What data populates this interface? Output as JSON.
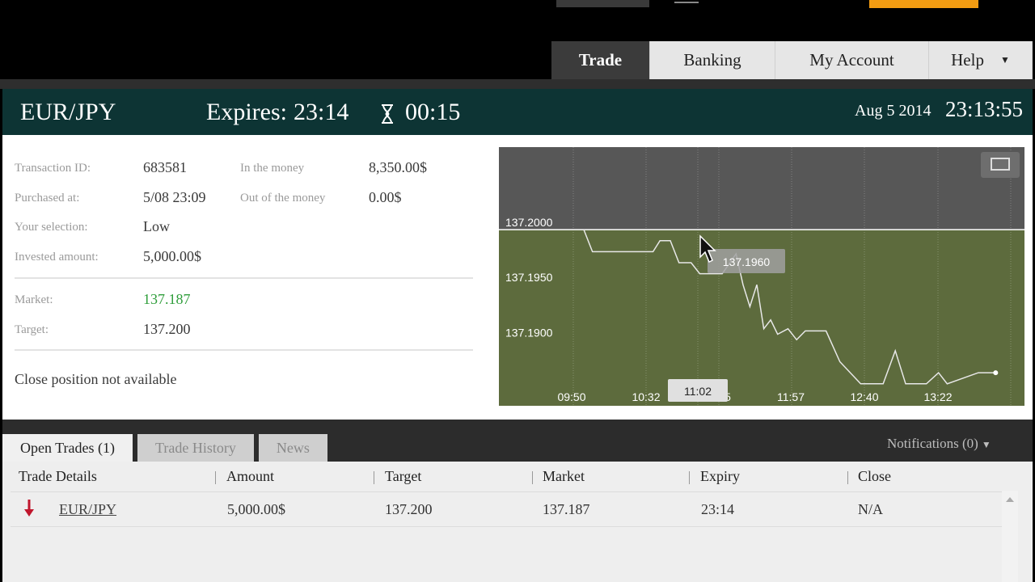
{
  "nav": {
    "tabs": [
      {
        "label": "Trade",
        "active": true
      },
      {
        "label": "Banking",
        "active": false
      },
      {
        "label": "My Account",
        "active": false
      },
      {
        "label": "Help",
        "active": false
      }
    ]
  },
  "header": {
    "asset": "EUR/JPY",
    "expires_label": "Expires:",
    "expires_time": "23:14",
    "countdown": "00:15",
    "date": "Aug 5 2014",
    "time": "23:13:55"
  },
  "details": {
    "transaction_id_label": "Transaction ID:",
    "transaction_id": "683581",
    "purchased_label": "Purchased at:",
    "purchased": "5/08 23:09",
    "selection_label": "Your selection:",
    "selection": "Low",
    "invested_label": "Invested amount:",
    "invested": "5,000.00$",
    "in_money_label": "In the money",
    "in_money": "8,350.00$",
    "out_money_label": "Out of the money",
    "out_money": "0.00$",
    "market_label": "Market:",
    "market": "137.187",
    "target_label": "Target:",
    "target": "137.200",
    "close_note": "Close position not available"
  },
  "chart_data": {
    "type": "line",
    "y_ticks": [
      "137.2000",
      "137.1950",
      "137.1900"
    ],
    "x_ticks": [
      "09:50",
      "10:32",
      "11:02",
      "5",
      "11:57",
      "12:40",
      "13:22"
    ],
    "hover_value": "137.1960",
    "hover_time": "11:02",
    "target": 137.2,
    "ylim": [
      137.184,
      137.2075
    ],
    "series": [
      {
        "values": [
          [
            0,
            137.2
          ],
          [
            5,
            137.198
          ],
          [
            40,
            137.198
          ],
          [
            44,
            137.199
          ],
          [
            50,
            137.199
          ],
          [
            55,
            137.197
          ],
          [
            62,
            137.197
          ],
          [
            67,
            137.196
          ],
          [
            80,
            137.196
          ],
          [
            88,
            137.1978
          ],
          [
            92,
            137.195
          ],
          [
            96,
            137.193
          ],
          [
            100,
            137.195
          ],
          [
            104,
            137.191
          ],
          [
            108,
            137.1918
          ],
          [
            112,
            137.1905
          ],
          [
            118,
            137.191
          ],
          [
            123,
            137.19
          ],
          [
            128,
            137.1908
          ],
          [
            140,
            137.1908
          ],
          [
            148,
            137.188
          ],
          [
            160,
            137.186
          ],
          [
            173,
            137.186
          ],
          [
            180,
            137.189
          ],
          [
            186,
            137.186
          ],
          [
            198,
            137.186
          ],
          [
            205,
            137.187
          ],
          [
            210,
            137.186
          ],
          [
            228,
            137.187
          ],
          [
            238,
            137.187
          ]
        ],
        "color": "#ffffff"
      }
    ],
    "colors": {
      "bg_top": "#575757",
      "bg_bottom": "#5d6b3d",
      "line": "#e8e8e8"
    }
  },
  "bottom": {
    "tabs": [
      {
        "label": "Open Trades (1)",
        "active": true
      },
      {
        "label": "Trade History",
        "active": false
      },
      {
        "label": "News",
        "active": false
      }
    ],
    "notifications": "Notifications (0)",
    "columns": [
      "Trade Details",
      "Amount",
      "Target",
      "Market",
      "Expiry",
      "Close"
    ],
    "rows": [
      {
        "asset": "EUR/JPY",
        "amount": "5,000.00$",
        "target": "137.200",
        "market": "137.187",
        "expiry": "23:14",
        "close": "N/A",
        "direction": "down"
      }
    ]
  },
  "colors": {
    "accent_orange": "#f39c12",
    "header_bg": "#0d3434",
    "arrow_red": "#c0162c"
  }
}
